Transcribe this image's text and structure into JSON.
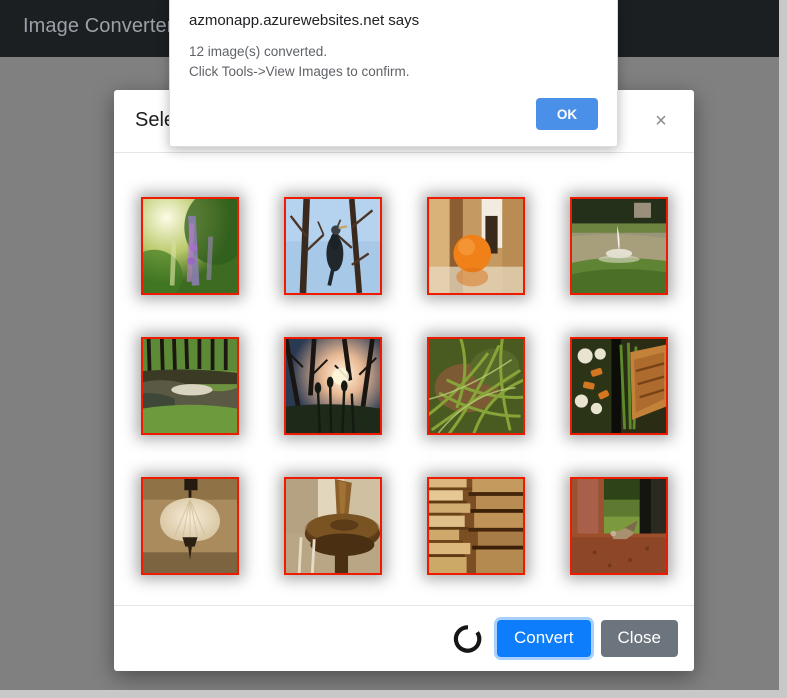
{
  "navbar": {
    "brand": "Image Converter"
  },
  "modal": {
    "title": "Select Images",
    "close_icon": "close-icon",
    "close_label": "×",
    "footer": {
      "spinner_icon": "loading-spinner-icon",
      "convert_label": "Convert",
      "close_label": "Close"
    },
    "thumbnails": [
      {
        "alt": "purple wildflower spike in green field",
        "selected": true
      },
      {
        "alt": "cormorant bird perched in bare tree branches",
        "selected": true
      },
      {
        "alt": "orange fruit on reflective table indoors",
        "selected": true
      },
      {
        "alt": "garden fountain in pond with green lawn",
        "selected": true
      },
      {
        "alt": "pond among trees in a park",
        "selected": true
      },
      {
        "alt": "sunset through silhouetted trees and reeds",
        "selected": true
      },
      {
        "alt": "green grass blades and dry leaves close up",
        "selected": true
      },
      {
        "alt": "grilled meat with vegetables on a plate",
        "selected": true
      },
      {
        "alt": "frosted glass pendant ceiling lamp",
        "selected": true
      },
      {
        "alt": "polished wooden chair back detail",
        "selected": true
      },
      {
        "alt": "stack of books seen edge on",
        "selected": true
      },
      {
        "alt": "bird on red brick ledge beside column",
        "selected": true
      }
    ]
  },
  "alert": {
    "title": "azmonapp.azurewebsites.net says",
    "message_line1": "12 image(s) converted.",
    "message_line2": "Click Tools->View Images to confirm.",
    "ok_label": "OK"
  },
  "colors": {
    "navbar_bg": "#1b1f22",
    "page_bg": "#808080",
    "thumb_border": "#ee1b00",
    "convert_btn": "#0d7dfb",
    "close_btn": "#6c757d",
    "alert_ok_btn": "#4a90e8"
  }
}
